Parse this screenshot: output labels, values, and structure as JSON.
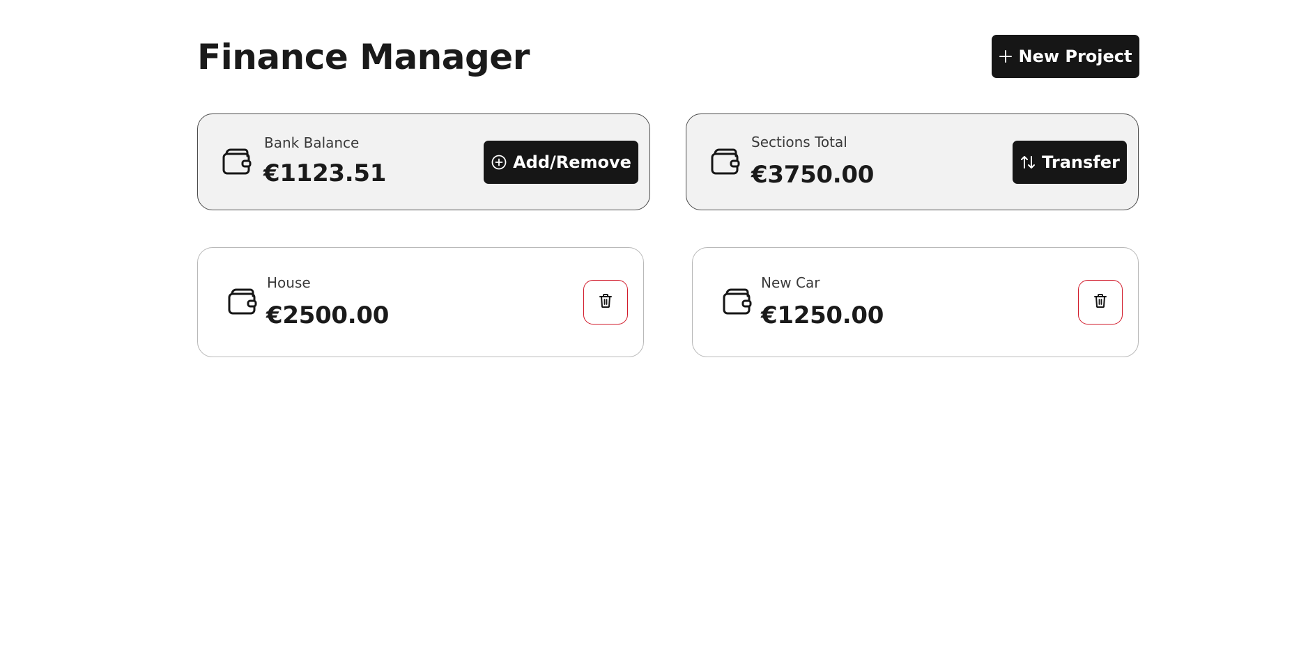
{
  "header": {
    "title": "Finance Manager",
    "new_project_label": "New Project"
  },
  "summary": {
    "bank": {
      "label": "Bank Balance",
      "value": "€1123.51",
      "button_label": "Add/Remove"
    },
    "sections_total": {
      "label": "Sections Total",
      "value": "€3750.00",
      "button_label": "Transfer"
    }
  },
  "sections": [
    {
      "label": "House",
      "value": "€2500.00"
    },
    {
      "label": "New Car",
      "value": "€1250.00"
    }
  ],
  "icons": {
    "wallet": "wallet-icon",
    "plus": "plus-icon",
    "plus_circle": "plus-circle-icon",
    "transfer": "arrows-up-down-icon",
    "trash": "trash-icon"
  },
  "colors": {
    "dark_button": "#161616",
    "summary_card_bg": "#f2f2f2",
    "delete_border": "#d11a2a",
    "text": "#1a1a1a"
  }
}
